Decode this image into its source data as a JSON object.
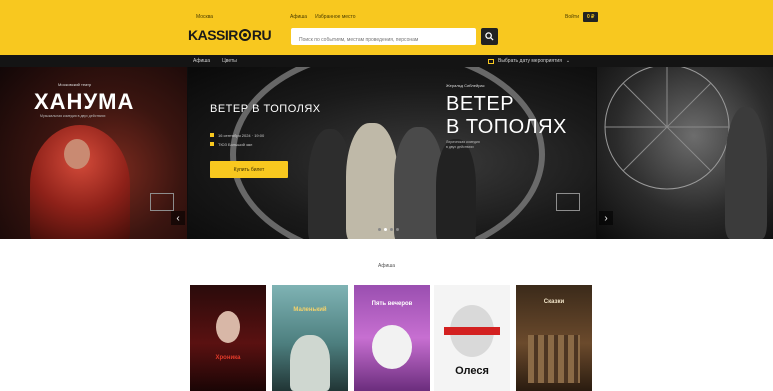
{
  "colors": {
    "accent": "#f8c81f",
    "dark": "#141414"
  },
  "header": {
    "city": "Москва",
    "logo_left": "KASSIR",
    "logo_right": "RU",
    "links": [
      "Афиша",
      "Избранное место"
    ],
    "search_placeholder": "Поиск по событиям, местам проведения, персонам",
    "login": "Войти",
    "cart": "0 ₽"
  },
  "subnav": {
    "items": [
      "Афиша",
      "Цветы"
    ],
    "date_picker": "Выбрать дату мероприятия"
  },
  "carousel": {
    "left": {
      "over": "Московский театр",
      "title": "ХАНУМА",
      "under": "Музыкальная комедия в двух действиях"
    },
    "main": {
      "title": "ВЕТЕР В ТОПОЛЯХ",
      "date": "16 сентября 2024 · 19:00",
      "venue": "ТЮЗ Большой зал",
      "buy_button": "Купить билет",
      "over": "Жеральд Сиблейрас",
      "big_line1": "ВЕТЕР",
      "big_line2": "В ТОПОЛЯХ",
      "under_line1": "Лирическая комедия",
      "under_line2": "в двух действиях"
    }
  },
  "section": {
    "title": "Афиша"
  },
  "posters": [
    {
      "label": "Хроника"
    },
    {
      "label": "Маленький"
    },
    {
      "label": "Пять вечеров"
    },
    {
      "label": "Олеся"
    },
    {
      "label": "Сказки"
    }
  ]
}
